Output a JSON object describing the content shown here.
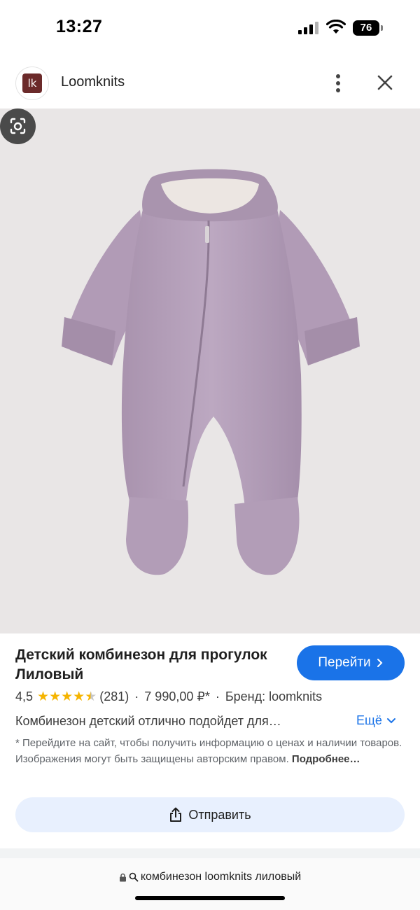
{
  "status_bar": {
    "time": "13:27",
    "battery": "76"
  },
  "header": {
    "site_name": "Loomknits",
    "logo_text": "lk"
  },
  "product": {
    "title": "Детский комбинезон для прогулок Лиловый",
    "go_button": "Перейти",
    "rating": "4,5",
    "rating_value": 4.5,
    "reviews": "(281)",
    "price": "7 990,00 ₽*",
    "brand": "Бренд: loomknits",
    "description": "Комбинезон детский отлично подойдет для…",
    "more_label": "Ещё",
    "disclaimer": "* Перейдите на сайт, чтобы получить информацию о ценах и наличии товаров. Изображения могут быть защищены авторским правом.",
    "disclaimer_more": "Подробнее…",
    "share_label": "Отправить"
  },
  "url_bar": {
    "query": "комбинезон loomknits лиловый"
  },
  "colors": {
    "accent": "#1a73e8",
    "garment": "#b9a3be",
    "logo_bg": "#6b2a2a",
    "star": "#f5b400"
  },
  "icons": [
    "lens-icon",
    "more-vert-icon",
    "close-icon",
    "chevron-right-icon",
    "chevron-down-icon",
    "share-icon",
    "lock-icon",
    "search-icon",
    "star-icon"
  ]
}
